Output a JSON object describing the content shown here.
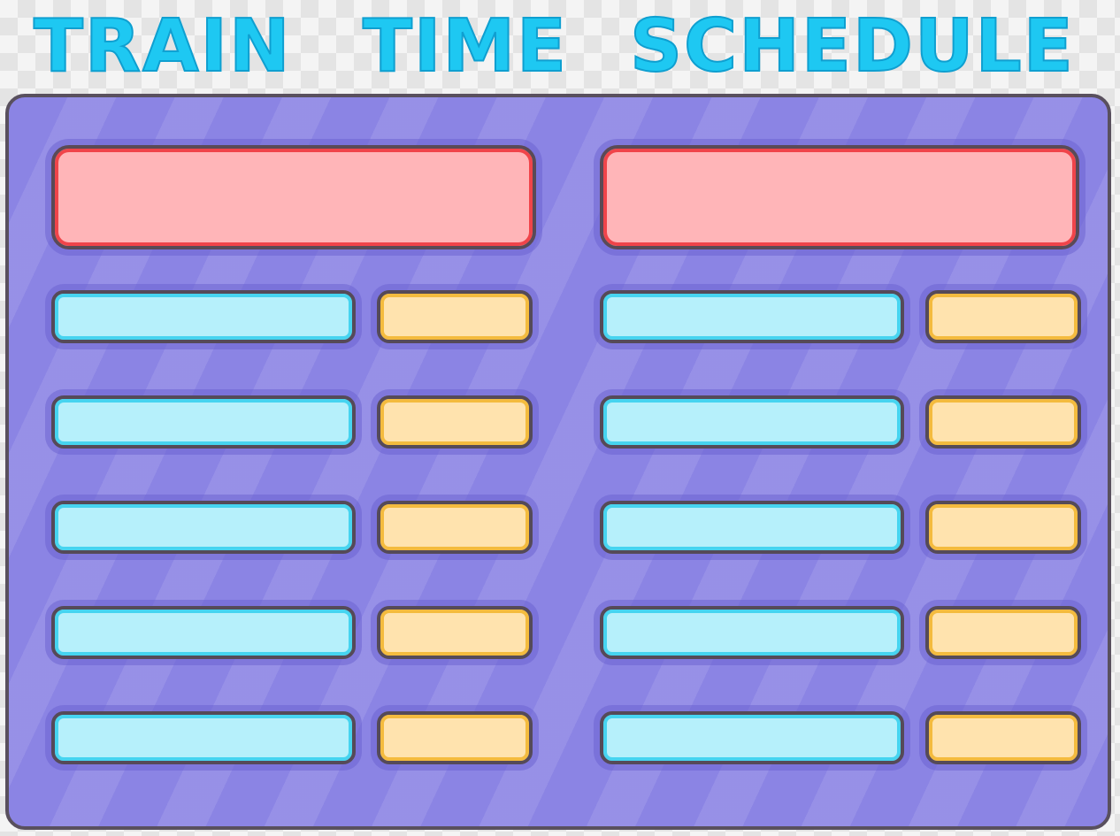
{
  "title": {
    "words": [
      "TRAIN",
      "TIME",
      "SCHEDULE"
    ]
  },
  "board": {
    "columns": 2,
    "rows_per_column": 5
  },
  "colors": {
    "title_fill": "#1ec8f2",
    "board": "#8b84e4",
    "header_fill": "#ffb5b8",
    "header_border": "#f0444a",
    "name_slot_fill": "#b6f0fb",
    "time_slot_fill": "#ffe3ae",
    "outline": "#554a58"
  }
}
